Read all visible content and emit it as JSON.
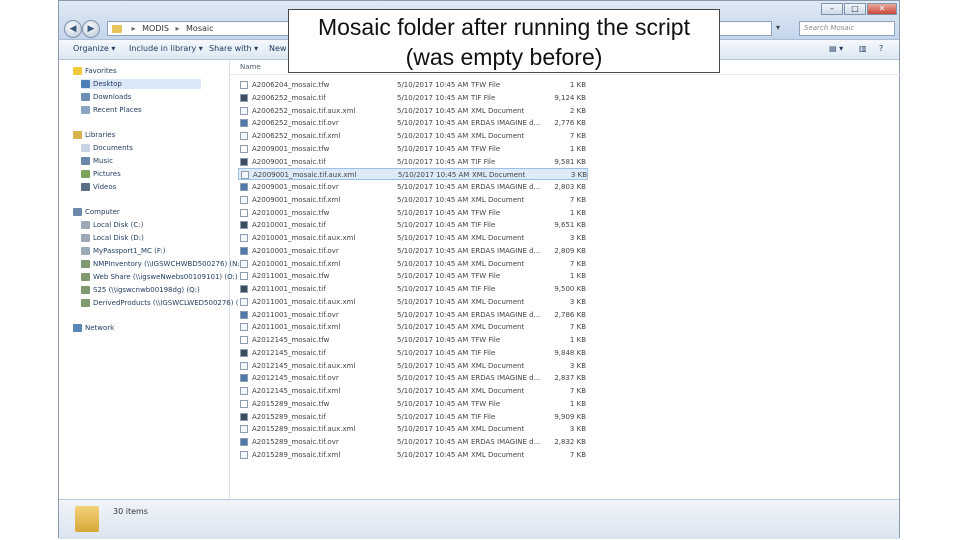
{
  "address": {
    "crumb1": "MODIS",
    "crumb2": "Mosaic"
  },
  "search": {
    "placeholder": "Search Mosaic"
  },
  "window_controls": {
    "minimize": "–",
    "maximize": "□",
    "close": "✕"
  },
  "toolbar": {
    "organize": "Organize ▾",
    "include": "Include in library ▾",
    "share": "Share with ▾",
    "new": "New f"
  },
  "columns": {
    "name": "Name"
  },
  "nav": {
    "favorites": "Favorites",
    "desktop": "Desktop",
    "downloads": "Downloads",
    "recent": "Recent Places",
    "libraries": "Libraries",
    "documents": "Documents",
    "music": "Music",
    "pictures": "Pictures",
    "videos": "Videos",
    "computer": "Computer",
    "local_c": "Local Disk (C:)",
    "local_d": "Local Disk (D:)",
    "passport": "MyPassport1_MC (F:)",
    "nmp": "NMPInventory (\\\\IGSWCHWBD500276) (N:)",
    "web": "Web Share (\\\\igsweNwebs00109101) (O:)",
    "s25": "S25 (\\\\igswcnwb00198dg) (Q:)",
    "derived": "DerivedProducts (\\\\IGSWCLWED500276) (",
    "network": "Network"
  },
  "files": [
    {
      "name": "A2006204_mosaic.tfw",
      "date": "5/10/2017 10:45 AM",
      "type": "TFW File",
      "size": "1 KB",
      "icon": "tfw"
    },
    {
      "name": "A2006252_mosaic.tif",
      "date": "5/10/2017 10:45 AM",
      "type": "TIF File",
      "size": "9,124 KB",
      "icon": "tif"
    },
    {
      "name": "A2006252_mosaic.tif.aux.xml",
      "date": "5/10/2017 10:45 AM",
      "type": "XML Document",
      "size": "2 KB",
      "icon": "xml"
    },
    {
      "name": "A2006252_mosaic.tif.ovr",
      "date": "5/10/2017 10:45 AM",
      "type": "ERDAS IMAGINE d...",
      "size": "2,776 KB",
      "icon": "ovr"
    },
    {
      "name": "A2006252_mosaic.tif.xml",
      "date": "5/10/2017 10:45 AM",
      "type": "XML Document",
      "size": "7 KB",
      "icon": "xml"
    },
    {
      "name": "A2009001_mosaic.tfw",
      "date": "5/10/2017 10:45 AM",
      "type": "TFW File",
      "size": "1 KB",
      "icon": "tfw"
    },
    {
      "name": "A2009001_mosaic.tif",
      "date": "5/10/2017 10:45 AM",
      "type": "TIF File",
      "size": "9,581 KB",
      "icon": "tif"
    },
    {
      "name": "A2009001_mosaic.tif.aux.xml",
      "date": "5/10/2017 10:45 AM",
      "type": "XML Document",
      "size": "3 KB",
      "icon": "xml",
      "selected": true
    },
    {
      "name": "A2009001_mosaic.tif.ovr",
      "date": "5/10/2017 10:45 AM",
      "type": "ERDAS IMAGINE d...",
      "size": "2,803 KB",
      "icon": "ovr"
    },
    {
      "name": "A2009001_mosaic.tif.xml",
      "date": "5/10/2017 10:45 AM",
      "type": "XML Document",
      "size": "7 KB",
      "icon": "xml"
    },
    {
      "name": "A2010001_mosaic.tfw",
      "date": "5/10/2017 10:45 AM",
      "type": "TFW File",
      "size": "1 KB",
      "icon": "tfw"
    },
    {
      "name": "A2010001_mosaic.tif",
      "date": "5/10/2017 10:45 AM",
      "type": "TIF File",
      "size": "9,651 KB",
      "icon": "tif"
    },
    {
      "name": "A2010001_mosaic.tif.aux.xml",
      "date": "5/10/2017 10:45 AM",
      "type": "XML Document",
      "size": "3 KB",
      "icon": "xml"
    },
    {
      "name": "A2010001_mosaic.tif.ovr",
      "date": "5/10/2017 10:45 AM",
      "type": "ERDAS IMAGINE d...",
      "size": "2,809 KB",
      "icon": "ovr"
    },
    {
      "name": "A2010001_mosaic.tif.xml",
      "date": "5/10/2017 10:45 AM",
      "type": "XML Document",
      "size": "7 KB",
      "icon": "xml"
    },
    {
      "name": "A2011001_mosaic.tfw",
      "date": "5/10/2017 10:45 AM",
      "type": "TFW File",
      "size": "1 KB",
      "icon": "tfw"
    },
    {
      "name": "A2011001_mosaic.tif",
      "date": "5/10/2017 10:45 AM",
      "type": "TIF File",
      "size": "9,500 KB",
      "icon": "tif"
    },
    {
      "name": "A2011001_mosaic.tif.aux.xml",
      "date": "5/10/2017 10:45 AM",
      "type": "XML Document",
      "size": "3 KB",
      "icon": "xml"
    },
    {
      "name": "A2011001_mosaic.tif.ovr",
      "date": "5/10/2017 10:45 AM",
      "type": "ERDAS IMAGINE d...",
      "size": "2,786 KB",
      "icon": "ovr"
    },
    {
      "name": "A2011001_mosaic.tif.xml",
      "date": "5/10/2017 10:45 AM",
      "type": "XML Document",
      "size": "7 KB",
      "icon": "xml"
    },
    {
      "name": "A2012145_mosaic.tfw",
      "date": "5/10/2017 10:45 AM",
      "type": "TFW File",
      "size": "1 KB",
      "icon": "tfw"
    },
    {
      "name": "A2012145_mosaic.tif",
      "date": "5/10/2017 10:45 AM",
      "type": "TIF File",
      "size": "9,848 KB",
      "icon": "tif"
    },
    {
      "name": "A2012145_mosaic.tif.aux.xml",
      "date": "5/10/2017 10:45 AM",
      "type": "XML Document",
      "size": "3 KB",
      "icon": "xml"
    },
    {
      "name": "A2012145_mosaic.tif.ovr",
      "date": "5/10/2017 10:45 AM",
      "type": "ERDAS IMAGINE d...",
      "size": "2,837 KB",
      "icon": "ovr"
    },
    {
      "name": "A2012145_mosaic.tif.xml",
      "date": "5/10/2017 10:45 AM",
      "type": "XML Document",
      "size": "7 KB",
      "icon": "xml"
    },
    {
      "name": "A2015289_mosaic.tfw",
      "date": "5/10/2017 10:45 AM",
      "type": "TFW File",
      "size": "1 KB",
      "icon": "tfw"
    },
    {
      "name": "A2015289_mosaic.tif",
      "date": "5/10/2017 10:45 AM",
      "type": "TIF File",
      "size": "9,909 KB",
      "icon": "tif"
    },
    {
      "name": "A2015289_mosaic.tif.aux.xml",
      "date": "5/10/2017 10:45 AM",
      "type": "XML Document",
      "size": "3 KB",
      "icon": "xml"
    },
    {
      "name": "A2015289_mosaic.tif.ovr",
      "date": "5/10/2017 10:45 AM",
      "type": "ERDAS IMAGINE d...",
      "size": "2,832 KB",
      "icon": "ovr"
    },
    {
      "name": "A2015289_mosaic.tif.xml",
      "date": "5/10/2017 10:45 AM",
      "type": "XML Document",
      "size": "7 KB",
      "icon": "xml"
    }
  ],
  "status": {
    "item_count": "30 items"
  },
  "callout": {
    "line1": "Mosaic folder after running the script",
    "line2": "(was empty before)"
  }
}
